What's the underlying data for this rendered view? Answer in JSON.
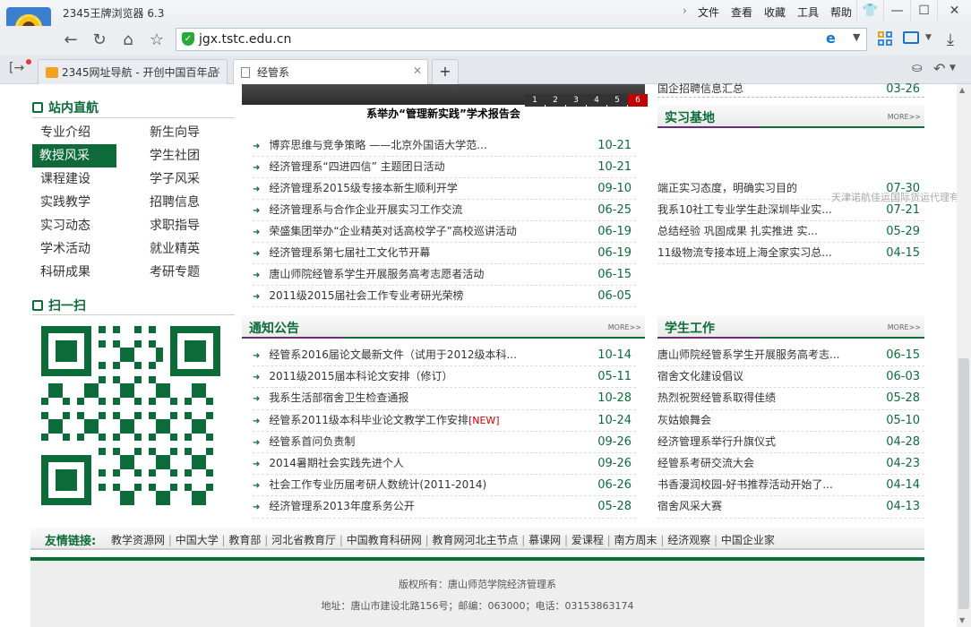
{
  "browser": {
    "title": "2345王牌浏览器 6.3",
    "menu": [
      "文件",
      "查看",
      "收藏",
      "工具",
      "帮助"
    ],
    "address": "jgx.tstc.edu.cn",
    "tabs": [
      {
        "label": "2345网址导航 - 开创中国百年品"
      },
      {
        "label": "经管系"
      }
    ],
    "new_tab": "+"
  },
  "banner": {
    "caption": "系举办“管理新实践”学术报告会",
    "pages": [
      "1",
      "2",
      "3",
      "4",
      "5",
      "6"
    ]
  },
  "sidebar": {
    "nav_title": "站内直航",
    "nav_items": [
      "专业介绍",
      "新生向导",
      "教授风采",
      "学生社团",
      "课程建设",
      "学子风采",
      "实践教学",
      "招聘信息",
      "实习动态",
      "求职指导",
      "学术活动",
      "就业精英",
      "科研成果",
      "考研专题"
    ],
    "scan_title": "扫一扫"
  },
  "news": [
    {
      "title": "博弈思维与竞争策略 ——北京外国语大学范...",
      "date": "10-21"
    },
    {
      "title": "经济管理系“四进四信” 主题团日活动",
      "date": "10-21"
    },
    {
      "title": "经济管理系2015级专接本新生顺利开学",
      "date": "09-10"
    },
    {
      "title": "经济管理系与合作企业开展实习工作交流",
      "date": "06-25"
    },
    {
      "title": "荣盛集团举办“企业精英对话高校学子”高校巡讲活动",
      "date": "06-19"
    },
    {
      "title": "经济管理系第七届社工文化节开幕",
      "date": "06-19"
    },
    {
      "title": "唐山师院经管系学生开展服务高考志愿者活动",
      "date": "06-15"
    },
    {
      "title": "2011级2015届社会工作专业考研光荣榜",
      "date": "06-05"
    }
  ],
  "recruit_top": {
    "title": "国企招聘信息汇总",
    "date": "03-26"
  },
  "internship": {
    "title": "实习基地",
    "more": "MORE>>",
    "items": [
      {
        "title": "端正实习态度，明确实习目的",
        "date": "07-30"
      },
      {
        "title": "我系10社工专业学生赴深圳毕业实...",
        "date": "07-21"
      },
      {
        "title": "总结经验 巩固成果 扎实推进 实...",
        "date": "05-29"
      },
      {
        "title": "11级物流专接本班上海全家实习总...",
        "date": "04-15"
      }
    ]
  },
  "marquee": "天津诺航佳运国际货运代理有",
  "notice": {
    "title": "通知公告",
    "more": "MORE>>",
    "items": [
      {
        "title": "经管系2016届论文最新文件（试用于2012级本科...",
        "date": "10-14",
        "tag": ""
      },
      {
        "title": "2011级2015届本科论文安排（修订）",
        "date": "05-11",
        "tag": ""
      },
      {
        "title": "我系生活部宿舍卫生检查通报",
        "date": "10-28",
        "tag": ""
      },
      {
        "title": "经管系2011级本科毕业论文教学工作安排",
        "date": "10-24",
        "tag": "[NEW]"
      },
      {
        "title": "经管系首问负责制",
        "date": "09-26",
        "tag": ""
      },
      {
        "title": "2014暑期社会实践先进个人",
        "date": "09-26",
        "tag": ""
      },
      {
        "title": "社会工作专业历届考研人数统计(2011-2014)",
        "date": "06-26",
        "tag": ""
      },
      {
        "title": "经济管理系2013年度系务公开",
        "date": "05-28",
        "tag": ""
      }
    ]
  },
  "student": {
    "title": "学生工作",
    "more": "MORE>>",
    "items": [
      {
        "title": "唐山师院经管系学生开展服务高考志...",
        "date": "06-15"
      },
      {
        "title": "宿舍文化建设倡议",
        "date": "06-03"
      },
      {
        "title": "热烈祝贺经管系取得佳绩",
        "date": "05-28"
      },
      {
        "title": "灰姑娘舞会",
        "date": "05-10"
      },
      {
        "title": "经济管理系举行升旗仪式",
        "date": "04-28"
      },
      {
        "title": "经管系考研交流大会",
        "date": "04-23"
      },
      {
        "title": "书香漫润校园-好书推荐活动开始了...",
        "date": "04-14"
      },
      {
        "title": "宿舍风采大赛",
        "date": "04-13"
      }
    ]
  },
  "links": {
    "label": "友情链接:",
    "items": [
      "教学资源网",
      "中国大学",
      "教育部",
      "河北省教育厅",
      "中国教育科研网",
      "教育网河北主节点",
      "慕课网",
      "爱课程",
      "南方周末",
      "经济观察",
      "中国企业家"
    ]
  },
  "footer": {
    "line1": "版权所有：唐山师范学院经济管理系",
    "line2": "地址：唐山市建设北路156号；邮编：063000；电话：03153863174"
  },
  "colors": {
    "accent": "#0d6b3a",
    "accent2": "#6b2a7a",
    "new_tag": "#cc0000",
    "active_page": "#c00000"
  }
}
